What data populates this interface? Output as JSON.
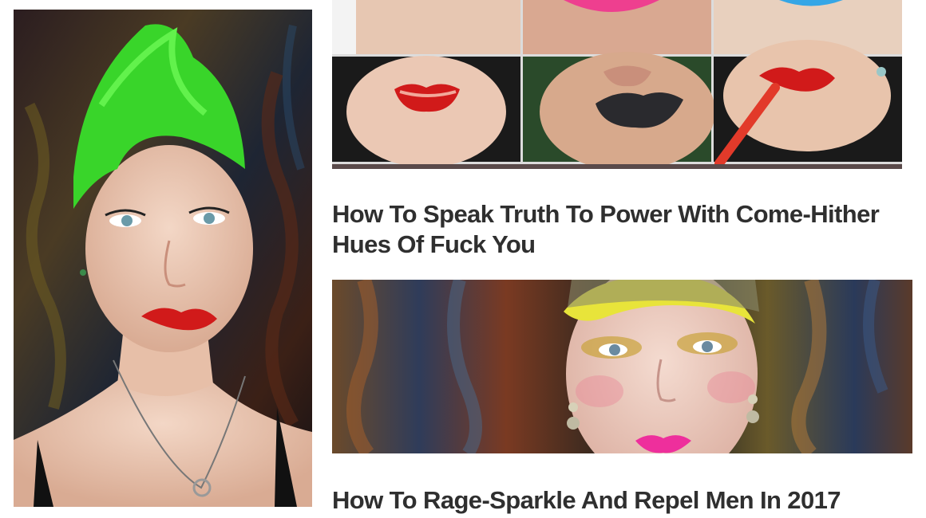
{
  "articles": [
    {
      "title": "How To Speak Truth To Power With Come-Hither Hues Of Fuck You"
    },
    {
      "title": "How To Rage-Sparkle And Repel Men In 2017"
    }
  ],
  "colors": {
    "hair_green": "#39d52a",
    "lip_red": "#d11a1a",
    "lip_black": "#2a2a2e",
    "lip_pink": "#ee2f9c",
    "hair_yellow": "#e8e43a"
  }
}
